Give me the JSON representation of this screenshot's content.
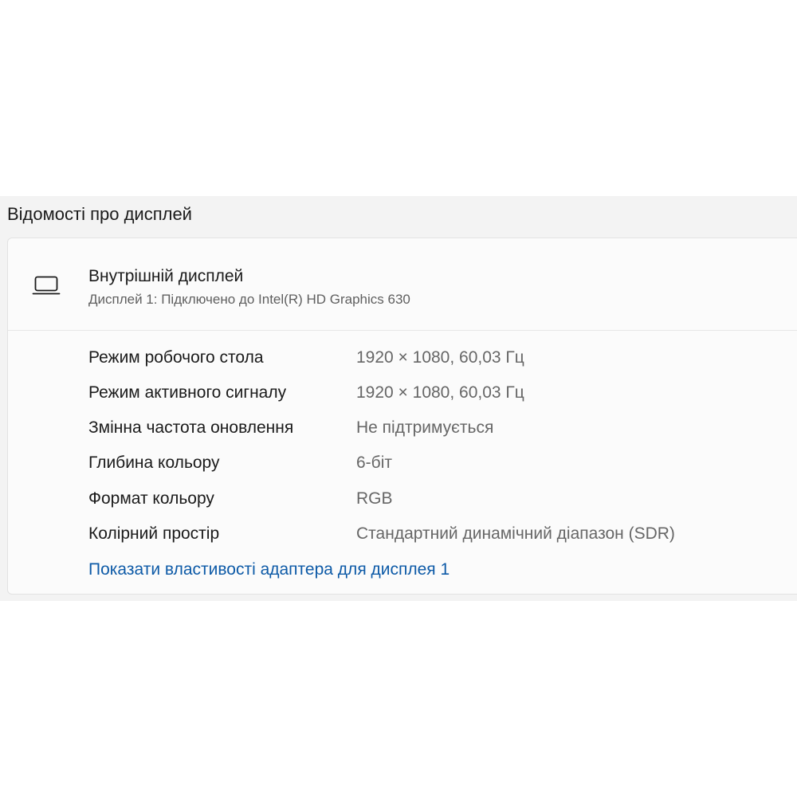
{
  "section": {
    "title": "Відомості про дисплей"
  },
  "display": {
    "icon": "laptop-icon",
    "name": "Внутрішній дисплей",
    "subtitle": "Дисплей 1: Підключено до Intel(R) HD Graphics 630"
  },
  "properties": [
    {
      "label": "Режим робочого стола",
      "value": "1920 × 1080, 60,03 Гц"
    },
    {
      "label": "Режим активного сигналу",
      "value": "1920 × 1080, 60,03 Гц"
    },
    {
      "label": "Змінна частота оновлення",
      "value": "Не підтримується"
    },
    {
      "label": "Глибина кольору",
      "value": "6-біт"
    },
    {
      "label": "Формат кольору",
      "value": "RGB"
    },
    {
      "label": "Колірний простір",
      "value": "Стандартний динамічний діапазон (SDR)"
    }
  ],
  "link": {
    "label": "Показати властивості адаптера для дисплея 1"
  },
  "colors": {
    "panel_background": "#f3f3f3",
    "card_background": "#fbfbfb",
    "link": "#0d5aa7",
    "secondary_text": "#666666"
  }
}
